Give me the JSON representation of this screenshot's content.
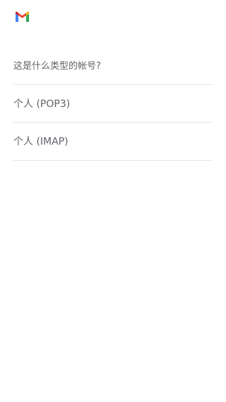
{
  "app": {
    "logo_icon": "gmail-logo-icon",
    "logo_colors": [
      "#4285F4",
      "#EA4335",
      "#FBBC04",
      "#34A853",
      "#C5221F"
    ]
  },
  "header": {
    "question": "这是什么类型的帐号?"
  },
  "account_types": [
    {
      "label": "个人 (POP3)"
    },
    {
      "label": "个人 (IMAP)"
    }
  ]
}
